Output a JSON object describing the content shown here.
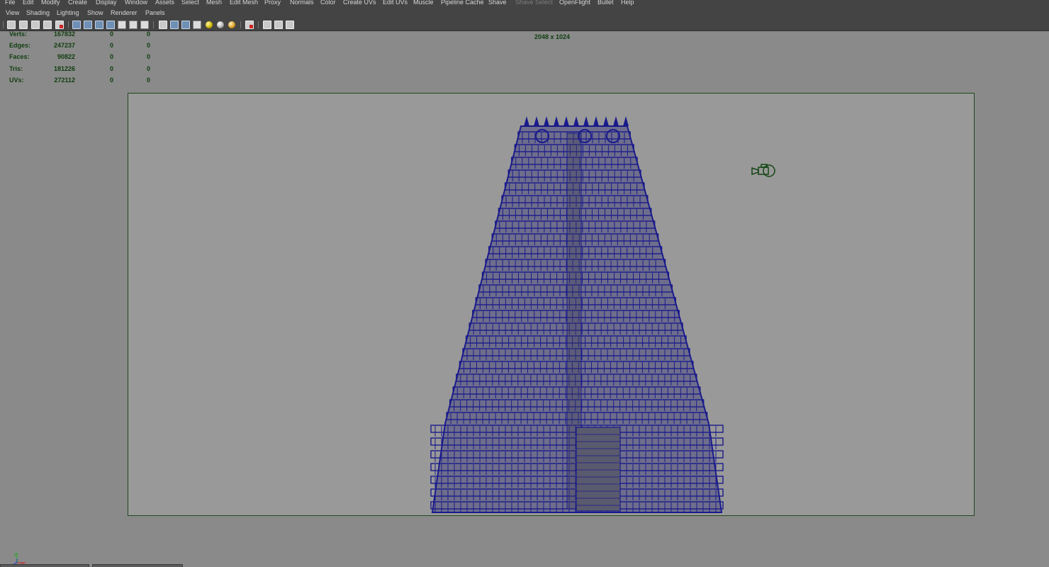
{
  "menubar": {
    "items": [
      "File",
      "Edit",
      "Modify",
      "Create",
      "Display",
      "Window",
      "Assets",
      "Select",
      "Mesh",
      "Edit Mesh",
      "Proxy",
      "Normals",
      "Color",
      "Create UVs",
      "Edit UVs",
      "Muscle",
      "Pipeline Cache",
      "Shave",
      "Shave Select",
      "OpenFlight",
      "Bullet",
      "Help"
    ]
  },
  "panel_menu": {
    "items": [
      "View",
      "Shading",
      "Lighting",
      "Show",
      "Renderer",
      "Panels"
    ]
  },
  "hud": {
    "rows": [
      {
        "label": "Verts:",
        "value": "167832",
        "selected": "0",
        "component": "0"
      },
      {
        "label": "Edges:",
        "value": "247237",
        "selected": "0",
        "component": "0"
      },
      {
        "label": "Faces:",
        "value": "90822",
        "selected": "0",
        "component": "0"
      },
      {
        "label": "Tris:",
        "value": "181226",
        "selected": "0",
        "component": "0"
      },
      {
        "label": "UVs:",
        "value": "272112",
        "selected": "0",
        "component": "0"
      }
    ]
  },
  "viewport": {
    "resolution_gate": "2048 x 1024",
    "wireframe_color": "#1a1a8c",
    "background_color": "#8a8a8a",
    "gate_color": "#999999",
    "hud_text_color": "#0f3d0f"
  },
  "axis_indicator": {
    "y": "y",
    "z": "z",
    "x": "x"
  }
}
